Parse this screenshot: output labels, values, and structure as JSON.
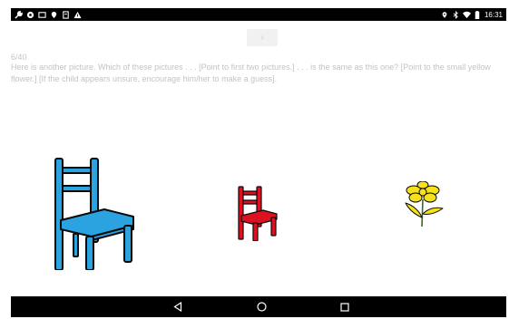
{
  "status_bar": {
    "left_icons": [
      "wrench-icon",
      "settings-icon",
      "cast-icon",
      "location-icon",
      "clipboard-icon",
      "warning-icon"
    ],
    "right_icons": [
      "location-pin-icon",
      "bluetooth-icon",
      "wifi-icon",
      "battery-icon"
    ],
    "time": "16:31"
  },
  "toolbar": {
    "next_label": "›"
  },
  "question": {
    "counter": "6/40",
    "prompt": "Here is another picture. Which of these pictures . . . [Point to first two pictures.] . . . is the same as this one? [Point to the small yellow flower.] [If the child appears unsure, encourage him/her to make a guess]."
  },
  "pictures": [
    {
      "name": "big-blue-chair",
      "color": "#2aa3e0"
    },
    {
      "name": "small-red-chair",
      "color": "#dc1222"
    },
    {
      "name": "small-yellow-flower",
      "color": "#f5e21a"
    }
  ],
  "nav_bar": {
    "buttons": [
      "back-icon",
      "home-icon",
      "recents-icon"
    ]
  },
  "colors": {
    "status_bar": "#000000",
    "text": "#c3c3c3",
    "chair_blue": "#2aa3e0",
    "chair_red": "#dc1222",
    "flower_yellow": "#f5e21a"
  }
}
